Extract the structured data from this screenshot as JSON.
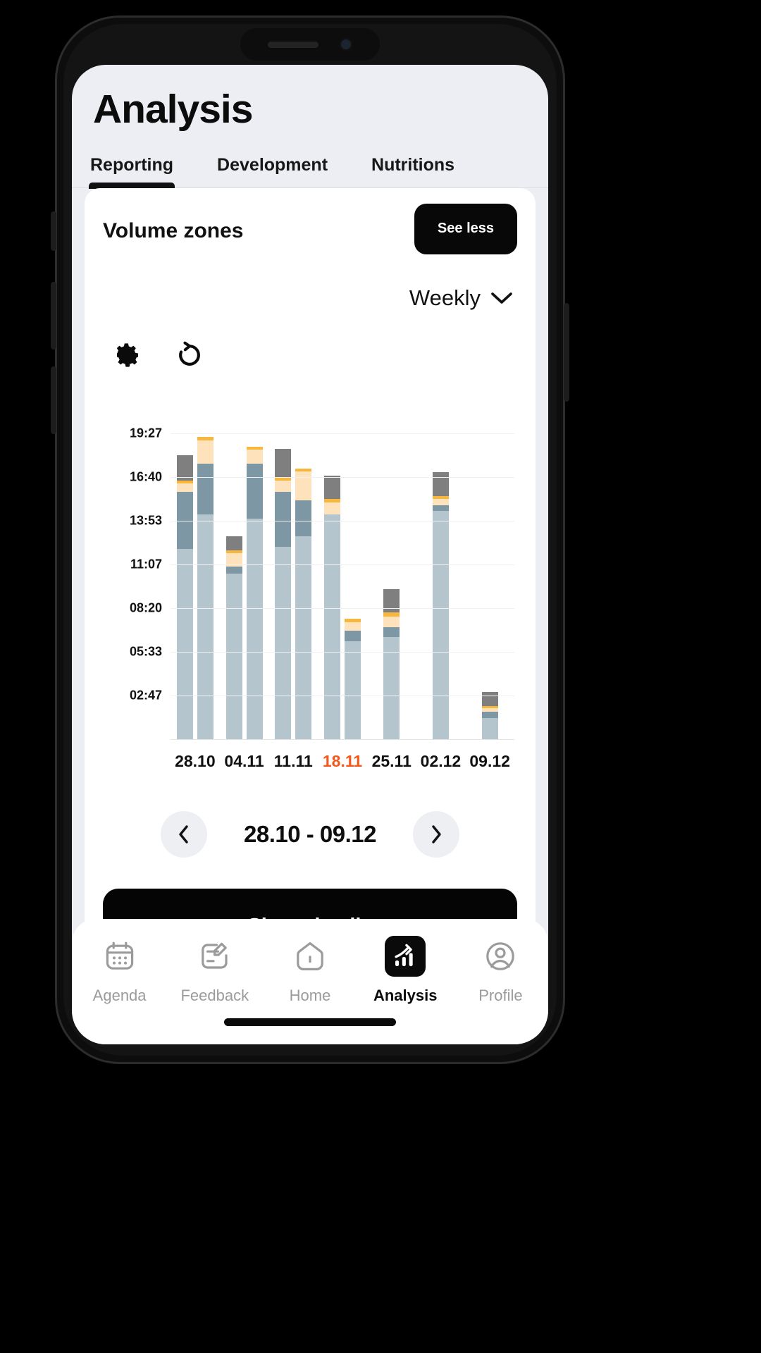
{
  "header": {
    "title": "Analysis"
  },
  "tabs": [
    {
      "label": "Reporting",
      "active": true
    },
    {
      "label": "Development",
      "active": false
    },
    {
      "label": "Nutritions",
      "active": false
    }
  ],
  "card": {
    "title": "Volume zones",
    "see_less_label": "See less",
    "period_label": "Weekly",
    "settings_icon": "gear-icon",
    "reset_icon": "reset-arrow-icon",
    "chevron_icon": "chevron-down-icon"
  },
  "range": {
    "prev_icon": "chevron-left-icon",
    "next_icon": "chevron-right-icon",
    "text": "28.10 - 09.12"
  },
  "show_details_label": "Show details",
  "bottom_nav": [
    {
      "label": "Agenda",
      "icon": "calendar-icon",
      "active": false
    },
    {
      "label": "Feedback",
      "icon": "note-edit-icon",
      "active": false
    },
    {
      "label": "Home",
      "icon": "home-icon",
      "active": false
    },
    {
      "label": "Analysis",
      "icon": "chart-up-icon",
      "active": true
    },
    {
      "label": "Profile",
      "icon": "person-icon",
      "active": false
    }
  ],
  "colors": {
    "zone1": "#b5c5cd",
    "zone2": "#7e97a5",
    "zone3": "#fde2bb",
    "zone4": "#f6b73c",
    "zone5": "#7f7f7f",
    "accent": "#f4581c",
    "dark": "#0a0a0a",
    "screen_bg": "#eceef3"
  },
  "chart_data": {
    "type": "bar",
    "title": "Volume zones",
    "stacked": true,
    "grouped": true,
    "xlabel": "",
    "ylabel": "",
    "grid": true,
    "legend": "none",
    "y_ticks": [
      "02:47",
      "05:33",
      "08:20",
      "11:07",
      "13:53",
      "16:40",
      "19:27"
    ],
    "y_tick_values": [
      2.78,
      5.55,
      8.33,
      11.12,
      13.88,
      16.67,
      19.45
    ],
    "ylim": [
      0,
      21.5
    ],
    "categories": [
      "28.10",
      "04.11",
      "11.11",
      "18.11",
      "25.11",
      "02.12",
      "09.12"
    ],
    "highlighted_category": "18.11",
    "series": [
      {
        "name": "Zone 1",
        "color": "#b5c5cd"
      },
      {
        "name": "Zone 2",
        "color": "#7e97a5"
      },
      {
        "name": "Zone 3",
        "color": "#fde2bb"
      },
      {
        "name": "Zone 4",
        "color": "#f6b73c"
      },
      {
        "name": "Zone 5",
        "color": "#7f7f7f"
      }
    ],
    "groups": [
      {
        "category": "28.10",
        "bars": [
          {
            "zone1": 12.1,
            "zone2": 3.6,
            "zone3": 0.55,
            "zone4": 0.2,
            "zone5": 1.6
          },
          {
            "zone1": 14.3,
            "zone2": 3.2,
            "zone3": 1.5,
            "zone4": 0.2,
            "zone5": 0.0
          }
        ]
      },
      {
        "category": "04.11",
        "bars": [
          {
            "zone1": 10.5,
            "zone2": 0.45,
            "zone3": 0.85,
            "zone4": 0.2,
            "zone5": 0.9
          },
          {
            "zone1": 14.0,
            "zone2": 3.5,
            "zone3": 0.9,
            "zone4": 0.2,
            "zone5": 0.0
          }
        ]
      },
      {
        "category": "11.11",
        "bars": [
          {
            "zone1": 12.2,
            "zone2": 3.5,
            "zone3": 0.75,
            "zone4": 0.2,
            "zone5": 1.8
          },
          {
            "zone1": 12.9,
            "zone2": 2.3,
            "zone3": 1.8,
            "zone4": 0.2,
            "zone5": 0.0
          }
        ]
      },
      {
        "category": "18.11",
        "bars": [
          {
            "zone1": 14.3,
            "zone2": 0.0,
            "zone3": 0.75,
            "zone4": 0.2,
            "zone5": 1.5
          },
          {
            "zone1": 6.2,
            "zone2": 0.7,
            "zone3": 0.55,
            "zone4": 0.2,
            "zone5": 0.0
          }
        ]
      },
      {
        "category": "25.11",
        "bars": [
          {
            "zone1": 6.5,
            "zone2": 0.6,
            "zone3": 0.7,
            "zone4": 0.25,
            "zone5": 1.5
          }
        ]
      },
      {
        "category": "02.12",
        "bars": [
          {
            "zone1": 14.5,
            "zone2": 0.35,
            "zone3": 0.4,
            "zone4": 0.2,
            "zone5": 1.5
          }
        ]
      },
      {
        "category": "09.12",
        "bars": [
          {
            "zone1": 1.35,
            "zone2": 0.4,
            "zone3": 0.2,
            "zone4": 0.15,
            "zone5": 0.9
          }
        ]
      }
    ]
  }
}
